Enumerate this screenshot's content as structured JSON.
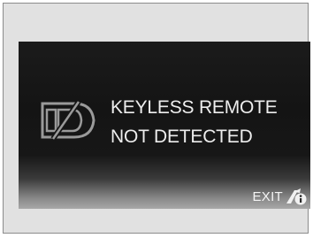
{
  "display": {
    "message_line1": "KEYLESS REMOTE",
    "message_line2": "NOT DETECTED",
    "exit_label": "EXIT",
    "icons": {
      "remote": "keyless-remote-icon",
      "exit": "exit-info-icon"
    }
  },
  "colors": {
    "screen_background": "#161616",
    "text": "#ededed",
    "panel": "#e1e1e1"
  }
}
